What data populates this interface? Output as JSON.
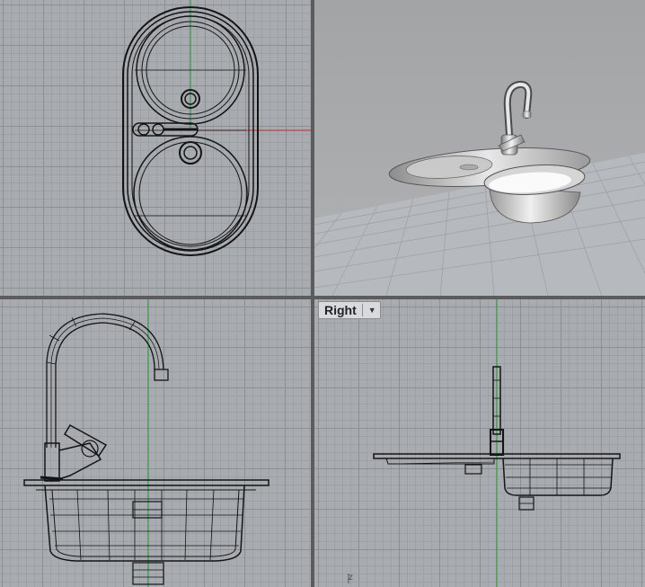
{
  "viewports": {
    "right": {
      "label": "Right",
      "menu_icon": "chevron-down-icon"
    },
    "axis_label": "z"
  },
  "colors": {
    "grid_bg": "#a8acb1",
    "grid_major": "#8b9096",
    "grid_minor": "#9ca1a6",
    "wire": "#141414",
    "y_axis": "#1f9a2f",
    "x_axis": "#c62828",
    "frame": "#5c5c5c"
  }
}
